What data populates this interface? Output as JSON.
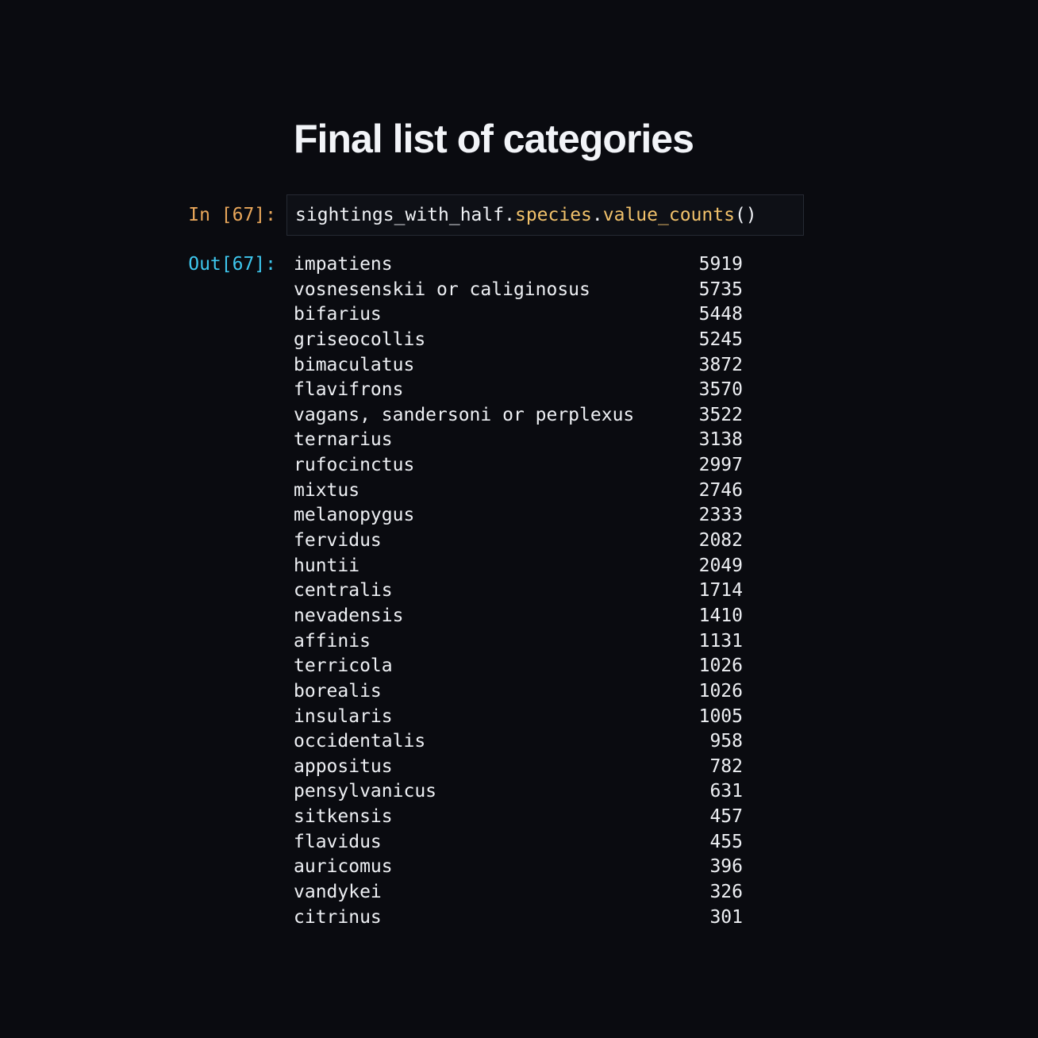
{
  "heading": "Final list of categories",
  "input_cell": {
    "prompt": "In [67]:",
    "code": {
      "object": "sightings_with_half",
      "dot1": ".",
      "attribute": "species",
      "dot2": ".",
      "method": "value_counts",
      "call": "()"
    }
  },
  "output_cell": {
    "prompt": "Out[67]:",
    "rows": [
      {
        "label": "impatiens",
        "count": "5919"
      },
      {
        "label": "vosnesenskii or caliginosus",
        "count": "5735"
      },
      {
        "label": "bifarius",
        "count": "5448"
      },
      {
        "label": "griseocollis",
        "count": "5245"
      },
      {
        "label": "bimaculatus",
        "count": "3872"
      },
      {
        "label": "flavifrons",
        "count": "3570"
      },
      {
        "label": "vagans, sandersoni or perplexus",
        "count": "3522"
      },
      {
        "label": "ternarius",
        "count": "3138"
      },
      {
        "label": "rufocinctus",
        "count": "2997"
      },
      {
        "label": "mixtus",
        "count": "2746"
      },
      {
        "label": "melanopygus",
        "count": "2333"
      },
      {
        "label": "fervidus",
        "count": "2082"
      },
      {
        "label": "huntii",
        "count": "2049"
      },
      {
        "label": "centralis",
        "count": "1714"
      },
      {
        "label": "nevadensis",
        "count": "1410"
      },
      {
        "label": "affinis",
        "count": "1131"
      },
      {
        "label": "terricola",
        "count": "1026"
      },
      {
        "label": "borealis",
        "count": "1026"
      },
      {
        "label": "insularis",
        "count": "1005"
      },
      {
        "label": "occidentalis",
        "count": "958"
      },
      {
        "label": "appositus",
        "count": "782"
      },
      {
        "label": "pensylvanicus",
        "count": "631"
      },
      {
        "label": "sitkensis",
        "count": "457"
      },
      {
        "label": "flavidus",
        "count": "455"
      },
      {
        "label": "auricomus",
        "count": "396"
      },
      {
        "label": "vandykei",
        "count": "326"
      },
      {
        "label": "citrinus",
        "count": "301"
      }
    ]
  },
  "colors": {
    "background": "#0a0b10",
    "in_prompt": "#e8a65a",
    "out_prompt": "#3ec7ee",
    "attribute": "#f2c26b",
    "text": "#eef0f4"
  }
}
